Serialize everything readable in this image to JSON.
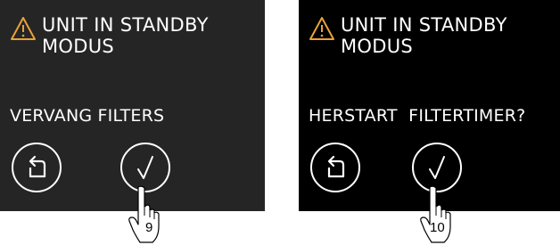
{
  "screens": [
    {
      "title_line1": "UNIT IN STANDBY",
      "title_line2": "MODUS",
      "message": "VERVANG FILTERS",
      "step": "9"
    },
    {
      "title_line1": "UNIT IN STANDBY",
      "title_line2": "MODUS",
      "message": "HERSTART  FILTERTIMER?",
      "step": "10"
    }
  ],
  "colors": {
    "warning": "#e8a13a",
    "screen1_bg": "#252525",
    "screen2_bg": "#000000",
    "foreground": "#ffffff"
  },
  "icons": [
    "warning-triangle-icon",
    "back-arrow-icon",
    "checkmark-icon",
    "pointing-hand-icon"
  ]
}
